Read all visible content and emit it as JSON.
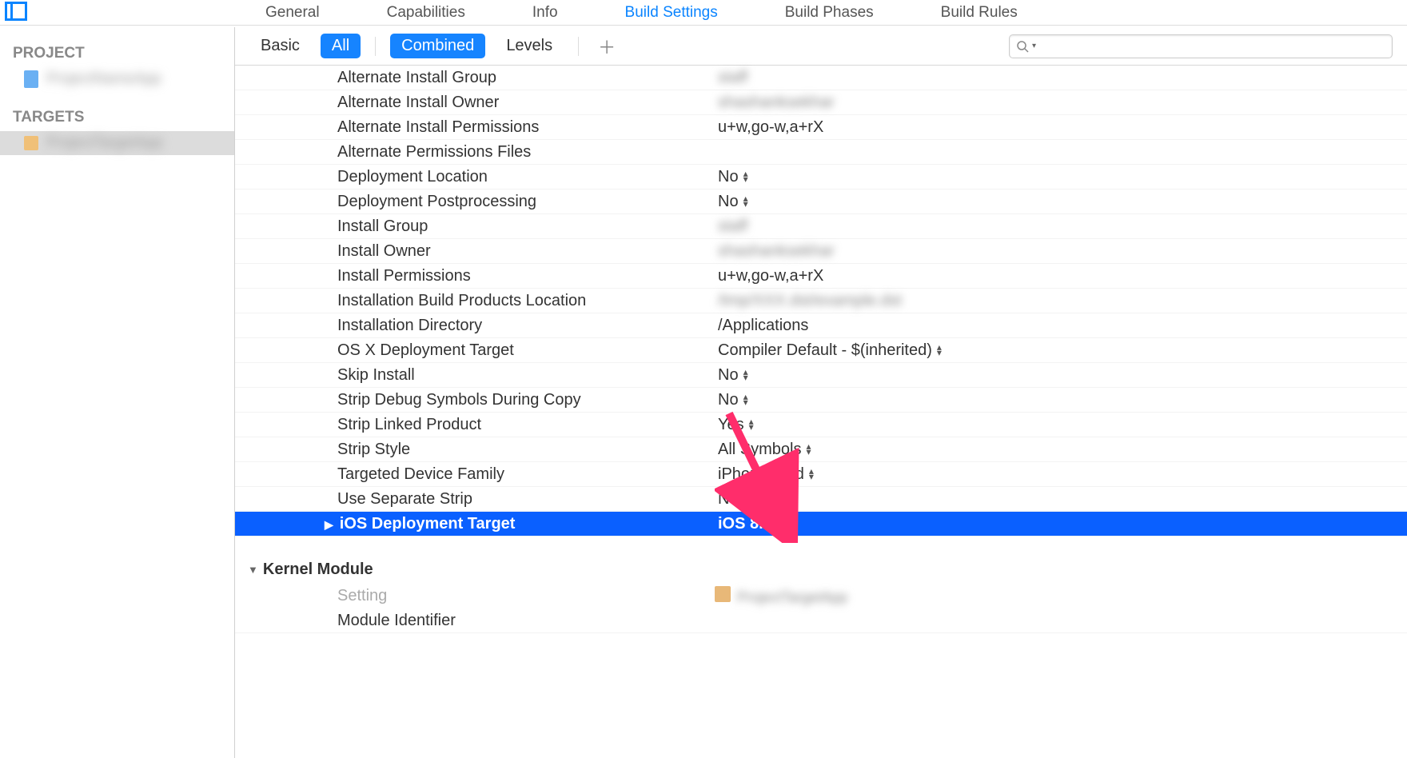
{
  "top_tabs": {
    "general": "General",
    "capabilities": "Capabilities",
    "info": "Info",
    "build_settings": "Build Settings",
    "build_phases": "Build Phases",
    "build_rules": "Build Rules",
    "active": "build_settings"
  },
  "sidebar": {
    "project_heading": "PROJECT",
    "targets_heading": "TARGETS",
    "project_name": "ProjectNameApp",
    "target_name": "ProjectTargetApp"
  },
  "filter_bar": {
    "basic": "Basic",
    "all": "All",
    "combined": "Combined",
    "levels": "Levels",
    "search_placeholder": ""
  },
  "settings": {
    "rows": [
      {
        "label": "Alternate Install Group",
        "value": "staff",
        "blur": true,
        "select": false
      },
      {
        "label": "Alternate Install Owner",
        "value": "shashanksekhar",
        "blur": true,
        "select": false
      },
      {
        "label": "Alternate Install Permissions",
        "value": "u+w,go-w,a+rX",
        "blur": false,
        "select": false
      },
      {
        "label": "Alternate Permissions Files",
        "value": "",
        "blur": false,
        "select": false
      },
      {
        "label": "Deployment Location",
        "value": "No",
        "blur": false,
        "select": true
      },
      {
        "label": "Deployment Postprocessing",
        "value": "No",
        "blur": false,
        "select": true
      },
      {
        "label": "Install Group",
        "value": "staff",
        "blur": true,
        "select": false
      },
      {
        "label": "Install Owner",
        "value": "shashanksekhar",
        "blur": true,
        "select": false
      },
      {
        "label": "Install Permissions",
        "value": "u+w,go-w,a+rX",
        "blur": false,
        "select": false
      },
      {
        "label": "Installation Build Products Location",
        "value": "/tmp/XXX.dst/example.dst",
        "blur": true,
        "select": false
      },
      {
        "label": "Installation Directory",
        "value": "/Applications",
        "blur": false,
        "select": false
      },
      {
        "label": "OS X Deployment Target",
        "value": "Compiler Default  -  $(inherited)",
        "blur": false,
        "select": true
      },
      {
        "label": "Skip Install",
        "value": "No",
        "blur": false,
        "select": true
      },
      {
        "label": "Strip Debug Symbols During Copy",
        "value": "No",
        "blur": false,
        "select": true
      },
      {
        "label": "Strip Linked Product",
        "value": "Yes",
        "blur": false,
        "select": true
      },
      {
        "label": "Strip Style",
        "value": "All Symbols",
        "blur": false,
        "select": true
      },
      {
        "label": "Targeted Device Family",
        "value": "iPhone/iPad",
        "blur": false,
        "select": true
      },
      {
        "label": "Use Separate Strip",
        "value": "No",
        "blur": false,
        "select": true
      }
    ],
    "highlighted": {
      "label": "iOS Deployment Target",
      "value": "iOS 8.3"
    },
    "section2": {
      "title": "Kernel Module",
      "subheader": "Setting",
      "rows": [
        {
          "label": "Module Identifier",
          "value": ""
        }
      ]
    }
  }
}
